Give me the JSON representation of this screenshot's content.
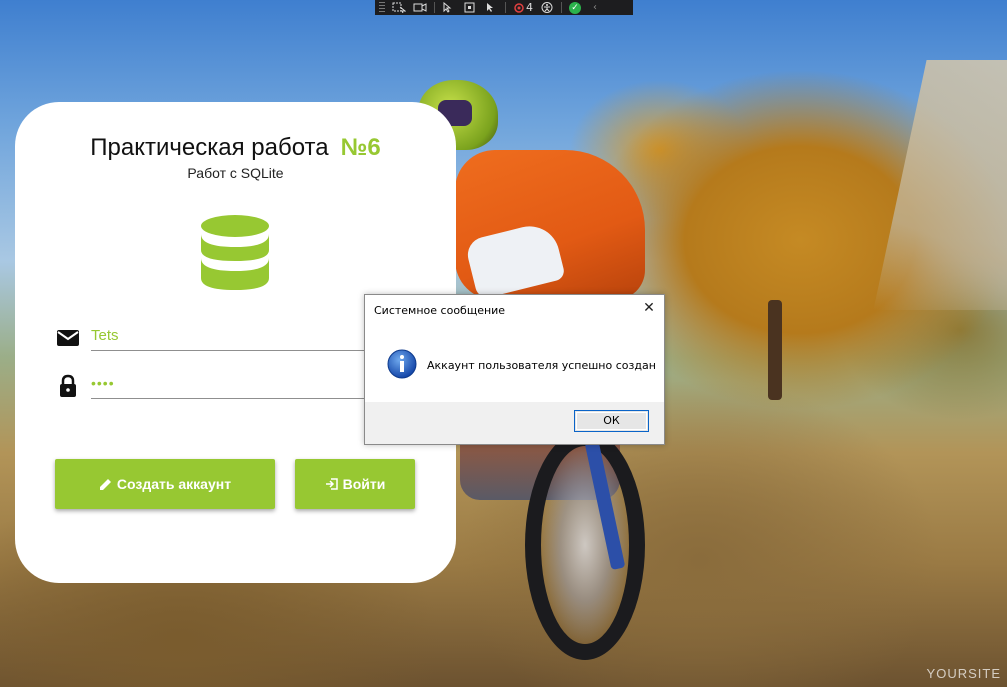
{
  "app": {
    "title": "Практическая работа",
    "number": "№6",
    "subtitle": "Работ с SQLite"
  },
  "form": {
    "login_value": "Tets",
    "password_value": "••••",
    "login_icon": "email-icon",
    "password_icon": "lock-icon"
  },
  "buttons": {
    "create_label": "Создать аккаунт",
    "login_label": "Войти"
  },
  "dialog": {
    "title": "Системное сообщение",
    "message": "Аккаунт пользователя успешно создан",
    "ok_label": "ОК",
    "icon": "info-icon"
  },
  "toolbar": {
    "badge_count": "4",
    "icons": [
      "select-element-icon",
      "video-icon",
      "cursor-icon",
      "frame-icon",
      "pointer-icon",
      "bug-icon",
      "accessibility-icon",
      "check-icon",
      "collapse-icon"
    ]
  },
  "watermark": "YOURSITE",
  "colors": {
    "accent": "#97c832",
    "card": "#ffffff",
    "dialog_footer": "#f0f0f0"
  }
}
